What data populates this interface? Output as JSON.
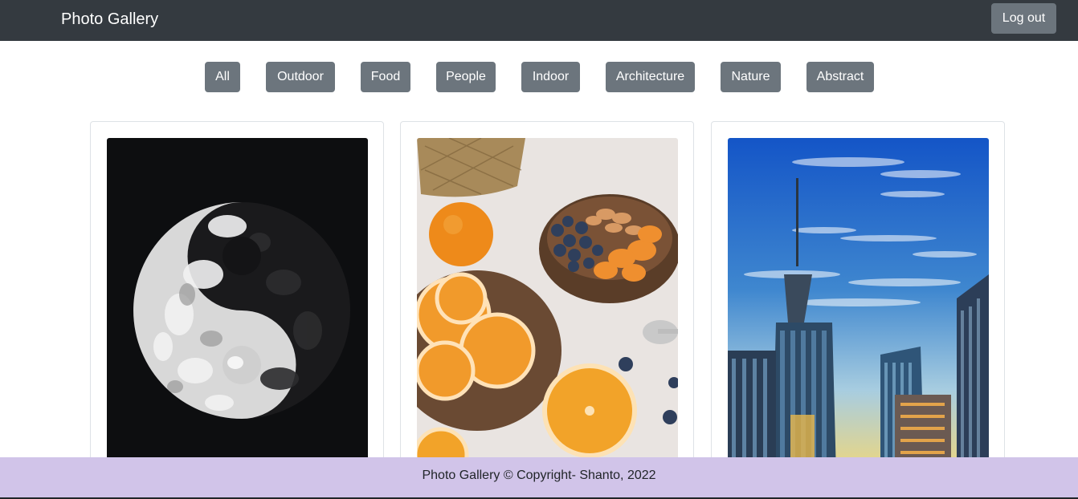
{
  "navbar": {
    "brand": "Photo Gallery",
    "logout_label": "Log out"
  },
  "filters": [
    "All",
    "Outdoor",
    "Food",
    "People",
    "Indoor",
    "Architecture",
    "Nature",
    "Abstract"
  ],
  "photos": [
    {
      "subject": "yin-yang abstract sculpture on black background"
    },
    {
      "subject": "coconut bowls with oranges, blueberries and almonds"
    },
    {
      "subject": "city skyscrapers against blue sky"
    }
  ],
  "footer": {
    "text": "Photo Gallery © Copyright- Shanto, 2022"
  },
  "colors": {
    "navbar": "#343a40",
    "button": "#6c757d",
    "footer": "#d1c4e9"
  }
}
